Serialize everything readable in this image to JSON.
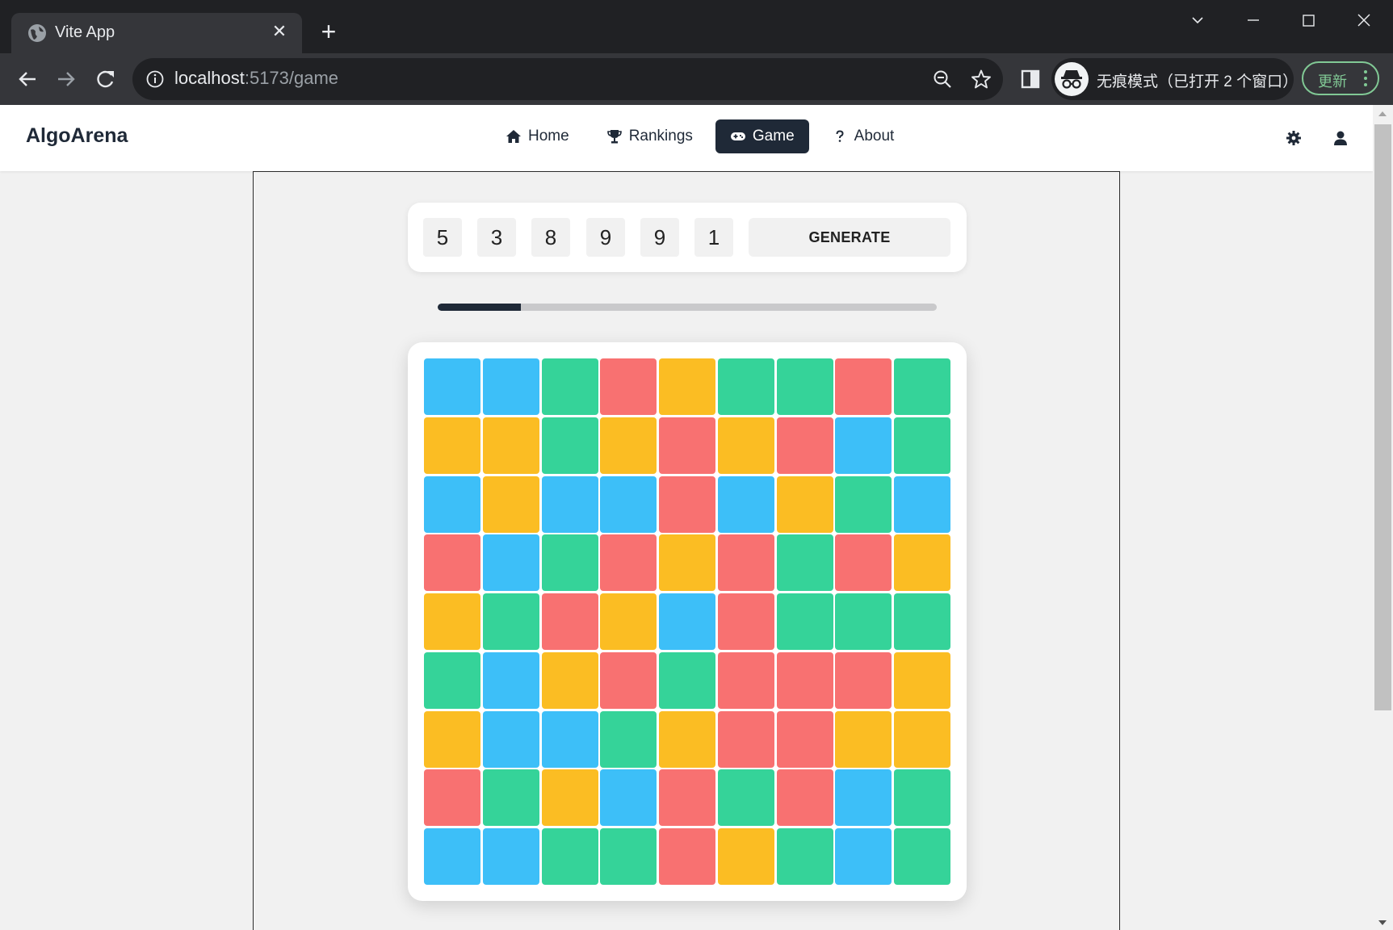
{
  "browser": {
    "tab_title": "Vite App",
    "tab_close": "✕",
    "new_tab": "+",
    "url_host": "localhost",
    "url_rest": ":5173/game",
    "incognito_label": "无痕模式（已打开 2 个窗口）",
    "update_label": "更新"
  },
  "app": {
    "brand": "AlgoArena",
    "nav": [
      {
        "label": "Home",
        "icon": "home-icon",
        "active": false
      },
      {
        "label": "Rankings",
        "icon": "trophy-icon",
        "active": false
      },
      {
        "label": "Game",
        "icon": "gamepad-icon",
        "active": true
      },
      {
        "label": "About",
        "icon": "question-icon",
        "active": false
      }
    ],
    "header_icons": [
      "settings-gear-icon",
      "user-icon"
    ]
  },
  "game": {
    "numbers": [
      "5",
      "3",
      "8",
      "9",
      "9",
      "1"
    ],
    "generate_label": "GENERATE",
    "progress": 0.167,
    "colors": {
      "B": "#3dbff8",
      "G": "#35d399",
      "R": "#f87171",
      "Y": "#fbbd23"
    },
    "grid": [
      [
        "B",
        "B",
        "G",
        "R",
        "Y",
        "G",
        "G",
        "R",
        "G"
      ],
      [
        "Y",
        "Y",
        "G",
        "Y",
        "R",
        "Y",
        "R",
        "B",
        "G"
      ],
      [
        "B",
        "Y",
        "B",
        "B",
        "R",
        "B",
        "Y",
        "G",
        "B"
      ],
      [
        "R",
        "B",
        "G",
        "R",
        "Y",
        "R",
        "G",
        "R",
        "Y"
      ],
      [
        "Y",
        "G",
        "R",
        "Y",
        "B",
        "R",
        "G",
        "G",
        "G"
      ],
      [
        "G",
        "B",
        "Y",
        "R",
        "G",
        "R",
        "R",
        "R",
        "Y"
      ],
      [
        "Y",
        "B",
        "B",
        "G",
        "Y",
        "R",
        "R",
        "Y",
        "Y"
      ],
      [
        "R",
        "G",
        "Y",
        "B",
        "R",
        "G",
        "R",
        "B",
        "G"
      ],
      [
        "B",
        "B",
        "G",
        "G",
        "R",
        "Y",
        "G",
        "B",
        "G"
      ]
    ]
  }
}
